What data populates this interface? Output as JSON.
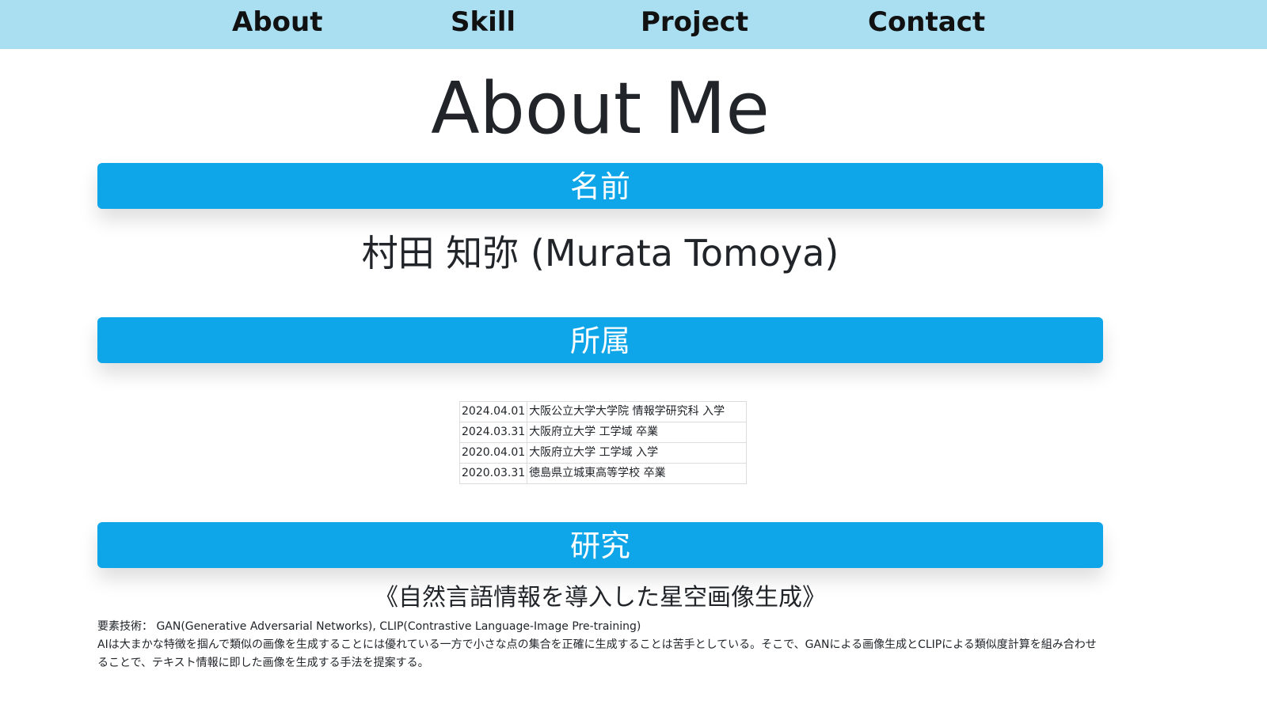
{
  "nav": {
    "items": [
      {
        "label": "About"
      },
      {
        "label": "Skill"
      },
      {
        "label": "Project"
      },
      {
        "label": "Contact"
      }
    ]
  },
  "page": {
    "title": "About Me"
  },
  "sections": {
    "name": {
      "heading": "名前",
      "value": "村田 知弥 (Murata Tomoya)"
    },
    "affiliation": {
      "heading": "所属",
      "rows": [
        {
          "date": "2024.04.01",
          "desc": "大阪公立大学大学院 情報学研究科 入学"
        },
        {
          "date": "2024.03.31",
          "desc": "大阪府立大学 工学域 卒業"
        },
        {
          "date": "2020.04.01",
          "desc": "大阪府立大学 工学域 入学"
        },
        {
          "date": "2020.03.31",
          "desc": "徳島県立城東高等学校 卒業"
        }
      ]
    },
    "research": {
      "heading": "研究",
      "title": "《自然言語情報を導入した星空画像生成》",
      "tech": "要素技術： GAN(Generative Adversarial Networks), CLIP(Contrastive Language-Image Pre-training)",
      "description": "AIは大まかな特徴を掴んで類似の画像を生成することには優れている一方で小さな点の集合を正確に生成することは苦手としている。そこで、GANによる画像生成とCLIPによる類似度計算を組み合わせることで、テキスト情報に即した画像を生成する手法を提案する。"
    }
  },
  "colors": {
    "nav_background": "#aadff2",
    "section_bar": "#0ea5e9",
    "text": "#212529"
  }
}
